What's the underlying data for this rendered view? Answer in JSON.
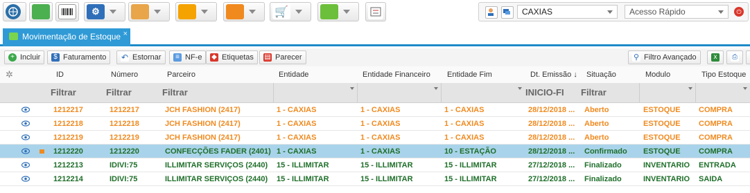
{
  "toolbar": {
    "buttons": [
      {
        "name": "globe-icon",
        "has_caret": false,
        "color": "#2b6fa8"
      },
      {
        "name": "bag-icon",
        "has_caret": false,
        "color": "#4caf50"
      },
      {
        "name": "barcode-icon",
        "has_caret": false,
        "color": "#888888"
      },
      {
        "name": "gear-icon",
        "has_caret": true,
        "color": "#2f6fb9"
      },
      {
        "name": "people-icon",
        "has_caret": true,
        "color": "#e0922c"
      },
      {
        "name": "chart-icon",
        "has_caret": true,
        "color": "#f4a300"
      },
      {
        "name": "box-icon",
        "has_caret": true,
        "color": "#f08a1f"
      },
      {
        "name": "cart-icon",
        "has_caret": true,
        "color": "#3aa84a"
      },
      {
        "name": "package-icon",
        "has_caret": true,
        "color": "#6cbf3a"
      },
      {
        "name": "checklist-icon",
        "has_caret": false,
        "color": "#666666"
      }
    ],
    "branch_select": "CAXIAS",
    "quick_access_placeholder": "Acesso Rápido"
  },
  "tab": {
    "label": "Movimentação de Estoque",
    "close": "×"
  },
  "actions": {
    "incluir": "Incluir",
    "faturamento": "Faturamento",
    "estornar": "Estornar",
    "nfe": "NF-e",
    "etiquetas": "Etiquetas",
    "parecer": "Parecer",
    "filtro_avancado": "Filtro Avançado"
  },
  "columns": {
    "id": "ID",
    "numero": "Número",
    "parceiro": "Parceiro",
    "entidade": "Entidade",
    "entidade_financeiro": "Entidade Financeiro",
    "entidade_fim": "Entidade Fim",
    "dt_emissao": "Dt. Emissão ↓",
    "situacao": "Situação",
    "modulo": "Modulo",
    "tipo_estoque": "Tipo Estoque"
  },
  "filters": {
    "id": "Filtrar",
    "numero": "Filtrar",
    "parceiro": "Filtrar",
    "dt_emissao": "INICIO-FI",
    "situacao": "Filtrar"
  },
  "rows": [
    {
      "id": "1212217",
      "numero": "1212217",
      "parceiro": "JCH FASHION (2417)",
      "entidade": "1 - CAXIAS",
      "entidade_financeiro": "1 - CAXIAS",
      "entidade_fim": "1 - CAXIAS",
      "dt_emissao": "28/12/2018 ...",
      "situacao": "Aberto",
      "modulo": "ESTOQUE",
      "tipo_estoque": "COMPRA",
      "color": "orange",
      "selected": false
    },
    {
      "id": "1212218",
      "numero": "1212218",
      "parceiro": "JCH FASHION (2417)",
      "entidade": "1 - CAXIAS",
      "entidade_financeiro": "1 - CAXIAS",
      "entidade_fim": "1 - CAXIAS",
      "dt_emissao": "28/12/2018 ...",
      "situacao": "Aberto",
      "modulo": "ESTOQUE",
      "tipo_estoque": "COMPRA",
      "color": "orange",
      "selected": false
    },
    {
      "id": "1212219",
      "numero": "1212219",
      "parceiro": "JCH FASHION (2417)",
      "entidade": "1 - CAXIAS",
      "entidade_financeiro": "1 - CAXIAS",
      "entidade_fim": "1 - CAXIAS",
      "dt_emissao": "28/12/2018 ...",
      "situacao": "Aberto",
      "modulo": "ESTOQUE",
      "tipo_estoque": "COMPRA",
      "color": "orange",
      "selected": false
    },
    {
      "id": "1212220",
      "numero": "1212220",
      "parceiro": "CONFECÇÕES FADER (2401)",
      "entidade": "1 - CAXIAS",
      "entidade_financeiro": "1 - CAXIAS",
      "entidade_fim": "10 - ESTAÇÃO",
      "dt_emissao": "28/12/2018 ...",
      "situacao": "Confirmado",
      "modulo": "ESTOQUE",
      "tipo_estoque": "COMPRA",
      "color": "green",
      "selected": true
    },
    {
      "id": "1212213",
      "numero": "IDIVI:75",
      "parceiro": "ILLIMITAR SERVIÇOS (2440)",
      "entidade": "15 - ILLIMITAR",
      "entidade_financeiro": "15 - ILLIMITAR",
      "entidade_fim": "15 - ILLIMITAR",
      "dt_emissao": "27/12/2018 ...",
      "situacao": "Finalizado",
      "modulo": "INVENTARIO",
      "tipo_estoque": "ENTRADA",
      "color": "green",
      "selected": false
    },
    {
      "id": "1212214",
      "numero": "IDIVI:75",
      "parceiro": "ILLIMITAR SERVIÇOS (2440)",
      "entidade": "15 - ILLIMITAR",
      "entidade_financeiro": "15 - ILLIMITAR",
      "entidade_fim": "15 - ILLIMITAR",
      "dt_emissao": "27/12/2018 ...",
      "situacao": "Finalizado",
      "modulo": "INVENTARIO",
      "tipo_estoque": "SAIDA",
      "color": "green",
      "selected": false
    }
  ]
}
